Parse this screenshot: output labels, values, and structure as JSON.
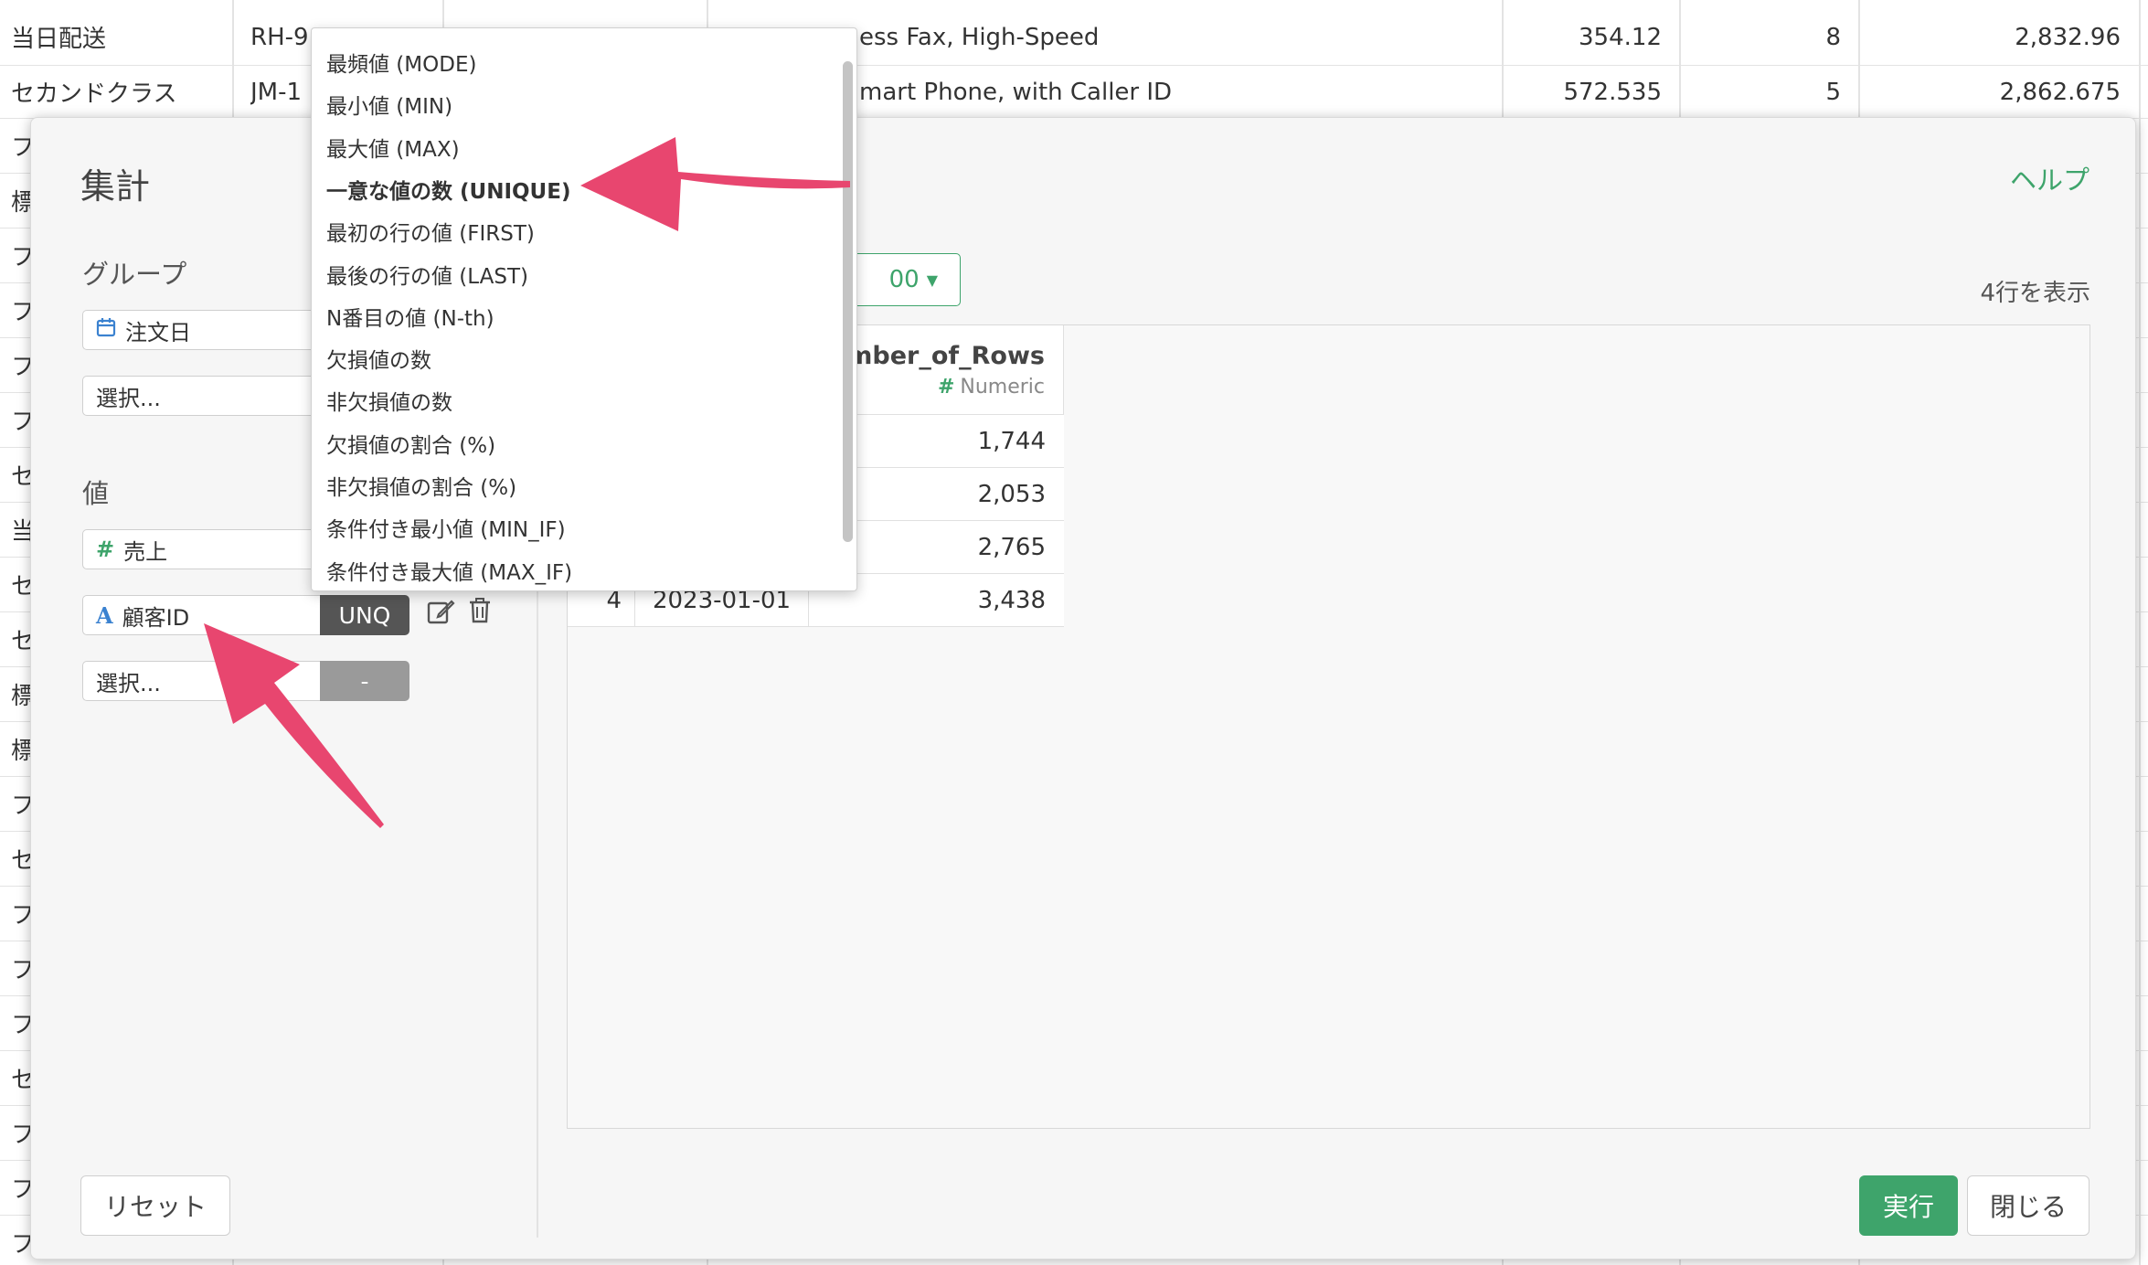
{
  "background_table": {
    "rows": [
      {
        "shipping": "当日配送",
        "code": "RH-9",
        "product": "ess Fax, High-Speed",
        "price": "354.12",
        "qty": "8",
        "total": "2,832.96"
      },
      {
        "shipping": "セカンドクラス",
        "code": "JM-1",
        "product": "mart Phone, with Caller ID",
        "price": "572.535",
        "qty": "5",
        "total": "2,862.675"
      }
    ],
    "left_stubs": [
      "フ",
      "標",
      "フ",
      "フ",
      "フ",
      "フ",
      "セ",
      "当",
      "セ",
      "セ",
      "標",
      "標",
      "フ",
      "セ",
      "フ",
      "フ",
      "フ",
      "セ",
      "フ",
      "フ",
      "フ"
    ]
  },
  "modal": {
    "title": "集計",
    "help": "ヘルプ",
    "group_label": "グループ",
    "group_fields": [
      {
        "icon": "calendar-icon",
        "label": "注文日"
      },
      {
        "label": "選択..."
      }
    ],
    "value_label": "値",
    "value_fields": [
      {
        "icon": "#",
        "label": "売上"
      },
      {
        "icon": "A",
        "label": "顧客ID",
        "agg": "UNQ"
      },
      {
        "label": "選択...",
        "agg": "-"
      }
    ],
    "limit_label": "00",
    "rows_shown": "4行を表示",
    "result": {
      "column_name": "umber_of_Rows",
      "column_type": "Numeric",
      "rows": [
        {
          "idx": "",
          "date": "",
          "value": "1,744"
        },
        {
          "idx": "",
          "date": "",
          "value": "2,053"
        },
        {
          "idx": "",
          "date": "",
          "value": "2,765"
        },
        {
          "idx": "4",
          "date": "2023-01-01",
          "value": "3,438"
        }
      ]
    },
    "reset": "リセット",
    "run": "実行",
    "close": "閉じる"
  },
  "dropdown": {
    "items": [
      "最頻値 (MODE)",
      "最小値 (MIN)",
      "最大値 (MAX)",
      "一意な値の数 (UNIQUE)",
      "最初の行の値 (FIRST)",
      "最後の行の値 (LAST)",
      "N番目の値 (N-th)",
      "欠損値の数",
      "非欠損値の数",
      "欠損値の割合 (%)",
      "非欠損値の割合 (%)",
      "条件付き最小値 (MIN_IF)",
      "条件付き最大値 (MAX_IF)"
    ],
    "selected_index": 3
  },
  "colors": {
    "accent": "#3ea46b",
    "arrow": "#e8466f",
    "agg_dark": "#555555",
    "agg_light": "#9a9a9a"
  }
}
